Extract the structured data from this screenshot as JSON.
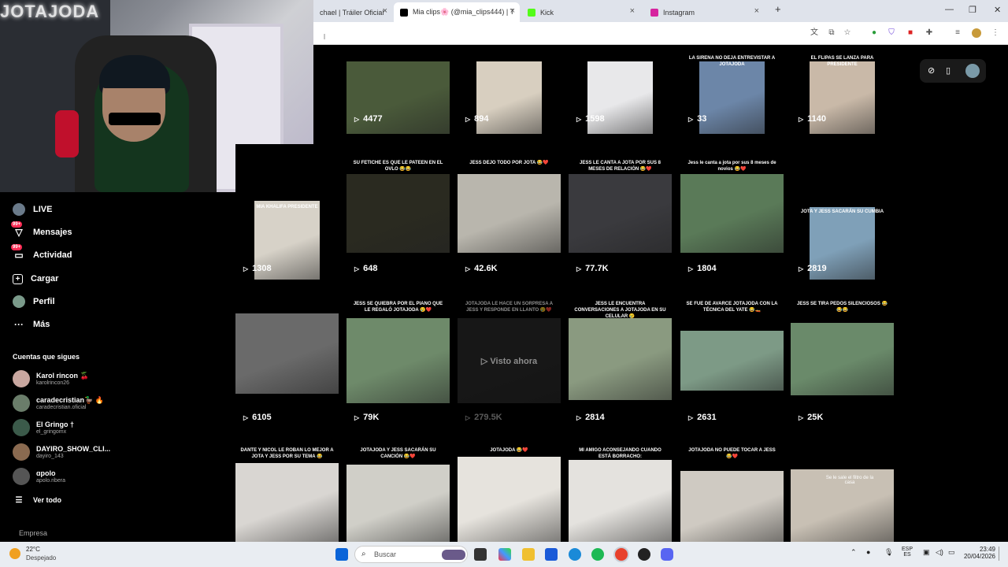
{
  "browser": {
    "tabs": [
      {
        "label": "chael | Tráiler Oficial",
        "favicon_color": "#ff0000",
        "active": false
      },
      {
        "label": "Mia clips🌸 (@mia_clips444) | T",
        "favicon_color": "#000000",
        "active": true
      },
      {
        "label": "Kick",
        "favicon_color": "#53fc18",
        "active": false
      },
      {
        "label": "Instagram",
        "favicon_color": "#d6249f",
        "active": false
      }
    ],
    "new_tab": "+",
    "close_glyph": "×"
  },
  "webcam": {
    "neon_text": "JOTAJODA"
  },
  "sidebar": {
    "nav": [
      {
        "label": "LIVE",
        "icon": "live-avatar-icon"
      },
      {
        "label": "Mensajes",
        "icon": "message-icon",
        "badge": "99+"
      },
      {
        "label": "Actividad",
        "icon": "activity-icon",
        "badge": "99+"
      },
      {
        "label": "Cargar",
        "icon": "upload-icon"
      },
      {
        "label": "Perfil",
        "icon": "profile-icon"
      },
      {
        "label": "Más",
        "icon": "more-icon"
      }
    ],
    "following_title": "Cuentas que sigues",
    "following": [
      {
        "name": "Karol rincon 🍒",
        "user": "karolrincon26",
        "color": "#c9a7a0"
      },
      {
        "name": "caradecristian🦆 🔥",
        "user": "caradecristian.oficial",
        "color": "#6a7d6a"
      },
      {
        "name": "El Gringo †",
        "user": "el_gringomx",
        "color": "#3b5a4a"
      },
      {
        "name": "DAYIRO_SHOW_CLI...",
        "user": "dayiro_143",
        "color": "#8a6a50"
      },
      {
        "name": "ɑpolo",
        "user": "apolo.ribera",
        "color": "#555"
      }
    ],
    "see_all": "Ver todo",
    "company": "Empresa"
  },
  "grid": {
    "row1": [
      {
        "views": "4477",
        "color": "#4a5a3a",
        "caption": ""
      },
      {
        "views": "894",
        "color": "#d8cfc0",
        "caption": ""
      },
      {
        "views": "1598",
        "color": "#e8e8ea",
        "caption": ""
      },
      {
        "views": "33",
        "color": "#6c86a8",
        "caption": "LA SIRENA NO DEJA ENTREVISTAR A JOTAJODA"
      },
      {
        "views": "1140",
        "color": "#c9b9a8",
        "caption": "EL FLIPAS SE LANZA PARA PRESIDENTE"
      }
    ],
    "row2": [
      {
        "views": "1308",
        "color": "#d7d2c8",
        "caption": "MIA KHALIFA PRESIDENTE"
      },
      {
        "views": "648",
        "color": "#2a2a20",
        "caption": "SU FETICHE ES QUE LE PATEEN EN EL OVLO 😂😂"
      },
      {
        "views": "42.6K",
        "color": "#b9b6ad",
        "caption": "JESS DEJO TODO POR JOTA 😂❤️"
      },
      {
        "views": "77.7K",
        "color": "#3a3a3e",
        "caption": "JESS LE CANTA A JOTA POR SUS 8 MESES DE RELACIÓN 😂❤️"
      },
      {
        "views": "1804",
        "color": "#5a7a58",
        "caption": "Jess le canta a jota por sus 8 meses de novios 😂❤️"
      },
      {
        "views": "2819",
        "color": "#7fa0b8",
        "caption": "JOTA Y JESS SACARÁN SU CUMBIA"
      }
    ],
    "row3": [
      {
        "views": "6105",
        "color": "#6a6a6a",
        "caption": ""
      },
      {
        "views": "79K",
        "color": "#6e8a6a",
        "caption": "JESS SE QUIEBRA POR EL PIANO QUE LE REGALÓ JOTAJODA 😢❤️"
      },
      {
        "views": "279.5K",
        "color": "#2b2b2b",
        "caption": "JOTAJODA LE HACE UN SORPRESA A JESS Y RESPONDE EN LLANTO 😢❤️",
        "overlay": "Visto ahora"
      },
      {
        "views": "2814",
        "color": "#8a9a80",
        "caption": "JESS LE ENCUENTRA CONVERSACIONES A JOTAJODA EN SU CELULAR 😢"
      },
      {
        "views": "2631",
        "color": "#7d9a86",
        "caption": "SE FUE DE AVARCE JOTAJODA CON LA TÉCNICA DEL YATE 😂🚤"
      },
      {
        "views": "25K",
        "color": "#6a8a6a",
        "caption": "JESS SE TIRA PEDOS SILENCIOSOS 😂😂😂"
      }
    ],
    "row4": [
      {
        "color": "#d9d6d2",
        "caption": "DANTE Y NICOL LE ROBAN LO MEJOR A JOTA Y JESS POR SU TEMA 😂"
      },
      {
        "color": "#d0cfc8",
        "caption": "JOTAJODA Y JESS SACARÁN SU CANCIÓN 😂❤️"
      },
      {
        "color": "#e6e3dd",
        "caption": "JOTAJODA 😂❤️"
      },
      {
        "color": "#e4e2de",
        "caption": "MI AMIGO ACONSEJANDO CUANDO ESTÁ BORRACHO:"
      },
      {
        "color": "#cfcac2",
        "caption": "JOTAJODA NO PUEDE TOCAR A JESS 😂❤️"
      },
      {
        "color": "#c8c0b4",
        "caption": "",
        "inner_text": "Se le sale el filtro de la casa"
      }
    ]
  },
  "taskbar": {
    "weather_temp": "22°C",
    "weather_desc": "Despejado",
    "search_placeholder": "Buscar",
    "lang": "ESP",
    "lang_sub": "ES",
    "time": "23:49",
    "date": "20/04/2026"
  }
}
